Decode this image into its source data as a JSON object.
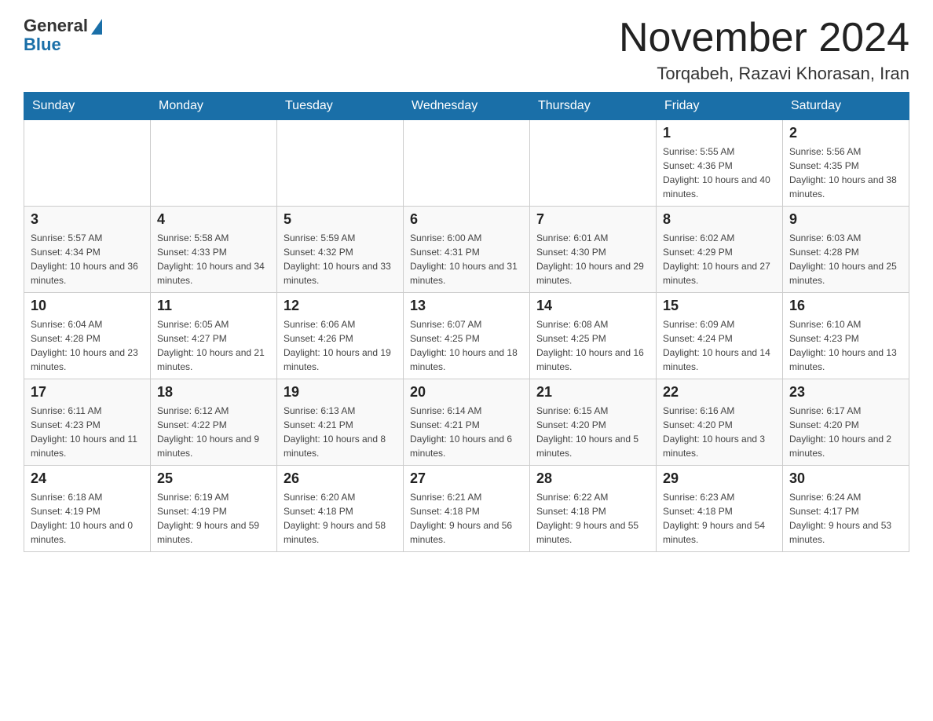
{
  "header": {
    "logo_general": "General",
    "logo_blue": "Blue",
    "month_title": "November 2024",
    "location": "Torqabeh, Razavi Khorasan, Iran"
  },
  "days_of_week": [
    "Sunday",
    "Monday",
    "Tuesday",
    "Wednesday",
    "Thursday",
    "Friday",
    "Saturday"
  ],
  "weeks": [
    [
      {
        "day": "",
        "sunrise": "",
        "sunset": "",
        "daylight": ""
      },
      {
        "day": "",
        "sunrise": "",
        "sunset": "",
        "daylight": ""
      },
      {
        "day": "",
        "sunrise": "",
        "sunset": "",
        "daylight": ""
      },
      {
        "day": "",
        "sunrise": "",
        "sunset": "",
        "daylight": ""
      },
      {
        "day": "",
        "sunrise": "",
        "sunset": "",
        "daylight": ""
      },
      {
        "day": "1",
        "sunrise": "Sunrise: 5:55 AM",
        "sunset": "Sunset: 4:36 PM",
        "daylight": "Daylight: 10 hours and 40 minutes."
      },
      {
        "day": "2",
        "sunrise": "Sunrise: 5:56 AM",
        "sunset": "Sunset: 4:35 PM",
        "daylight": "Daylight: 10 hours and 38 minutes."
      }
    ],
    [
      {
        "day": "3",
        "sunrise": "Sunrise: 5:57 AM",
        "sunset": "Sunset: 4:34 PM",
        "daylight": "Daylight: 10 hours and 36 minutes."
      },
      {
        "day": "4",
        "sunrise": "Sunrise: 5:58 AM",
        "sunset": "Sunset: 4:33 PM",
        "daylight": "Daylight: 10 hours and 34 minutes."
      },
      {
        "day": "5",
        "sunrise": "Sunrise: 5:59 AM",
        "sunset": "Sunset: 4:32 PM",
        "daylight": "Daylight: 10 hours and 33 minutes."
      },
      {
        "day": "6",
        "sunrise": "Sunrise: 6:00 AM",
        "sunset": "Sunset: 4:31 PM",
        "daylight": "Daylight: 10 hours and 31 minutes."
      },
      {
        "day": "7",
        "sunrise": "Sunrise: 6:01 AM",
        "sunset": "Sunset: 4:30 PM",
        "daylight": "Daylight: 10 hours and 29 minutes."
      },
      {
        "day": "8",
        "sunrise": "Sunrise: 6:02 AM",
        "sunset": "Sunset: 4:29 PM",
        "daylight": "Daylight: 10 hours and 27 minutes."
      },
      {
        "day": "9",
        "sunrise": "Sunrise: 6:03 AM",
        "sunset": "Sunset: 4:28 PM",
        "daylight": "Daylight: 10 hours and 25 minutes."
      }
    ],
    [
      {
        "day": "10",
        "sunrise": "Sunrise: 6:04 AM",
        "sunset": "Sunset: 4:28 PM",
        "daylight": "Daylight: 10 hours and 23 minutes."
      },
      {
        "day": "11",
        "sunrise": "Sunrise: 6:05 AM",
        "sunset": "Sunset: 4:27 PM",
        "daylight": "Daylight: 10 hours and 21 minutes."
      },
      {
        "day": "12",
        "sunrise": "Sunrise: 6:06 AM",
        "sunset": "Sunset: 4:26 PM",
        "daylight": "Daylight: 10 hours and 19 minutes."
      },
      {
        "day": "13",
        "sunrise": "Sunrise: 6:07 AM",
        "sunset": "Sunset: 4:25 PM",
        "daylight": "Daylight: 10 hours and 18 minutes."
      },
      {
        "day": "14",
        "sunrise": "Sunrise: 6:08 AM",
        "sunset": "Sunset: 4:25 PM",
        "daylight": "Daylight: 10 hours and 16 minutes."
      },
      {
        "day": "15",
        "sunrise": "Sunrise: 6:09 AM",
        "sunset": "Sunset: 4:24 PM",
        "daylight": "Daylight: 10 hours and 14 minutes."
      },
      {
        "day": "16",
        "sunrise": "Sunrise: 6:10 AM",
        "sunset": "Sunset: 4:23 PM",
        "daylight": "Daylight: 10 hours and 13 minutes."
      }
    ],
    [
      {
        "day": "17",
        "sunrise": "Sunrise: 6:11 AM",
        "sunset": "Sunset: 4:23 PM",
        "daylight": "Daylight: 10 hours and 11 minutes."
      },
      {
        "day": "18",
        "sunrise": "Sunrise: 6:12 AM",
        "sunset": "Sunset: 4:22 PM",
        "daylight": "Daylight: 10 hours and 9 minutes."
      },
      {
        "day": "19",
        "sunrise": "Sunrise: 6:13 AM",
        "sunset": "Sunset: 4:21 PM",
        "daylight": "Daylight: 10 hours and 8 minutes."
      },
      {
        "day": "20",
        "sunrise": "Sunrise: 6:14 AM",
        "sunset": "Sunset: 4:21 PM",
        "daylight": "Daylight: 10 hours and 6 minutes."
      },
      {
        "day": "21",
        "sunrise": "Sunrise: 6:15 AM",
        "sunset": "Sunset: 4:20 PM",
        "daylight": "Daylight: 10 hours and 5 minutes."
      },
      {
        "day": "22",
        "sunrise": "Sunrise: 6:16 AM",
        "sunset": "Sunset: 4:20 PM",
        "daylight": "Daylight: 10 hours and 3 minutes."
      },
      {
        "day": "23",
        "sunrise": "Sunrise: 6:17 AM",
        "sunset": "Sunset: 4:20 PM",
        "daylight": "Daylight: 10 hours and 2 minutes."
      }
    ],
    [
      {
        "day": "24",
        "sunrise": "Sunrise: 6:18 AM",
        "sunset": "Sunset: 4:19 PM",
        "daylight": "Daylight: 10 hours and 0 minutes."
      },
      {
        "day": "25",
        "sunrise": "Sunrise: 6:19 AM",
        "sunset": "Sunset: 4:19 PM",
        "daylight": "Daylight: 9 hours and 59 minutes."
      },
      {
        "day": "26",
        "sunrise": "Sunrise: 6:20 AM",
        "sunset": "Sunset: 4:18 PM",
        "daylight": "Daylight: 9 hours and 58 minutes."
      },
      {
        "day": "27",
        "sunrise": "Sunrise: 6:21 AM",
        "sunset": "Sunset: 4:18 PM",
        "daylight": "Daylight: 9 hours and 56 minutes."
      },
      {
        "day": "28",
        "sunrise": "Sunrise: 6:22 AM",
        "sunset": "Sunset: 4:18 PM",
        "daylight": "Daylight: 9 hours and 55 minutes."
      },
      {
        "day": "29",
        "sunrise": "Sunrise: 6:23 AM",
        "sunset": "Sunset: 4:18 PM",
        "daylight": "Daylight: 9 hours and 54 minutes."
      },
      {
        "day": "30",
        "sunrise": "Sunrise: 6:24 AM",
        "sunset": "Sunset: 4:17 PM",
        "daylight": "Daylight: 9 hours and 53 minutes."
      }
    ]
  ]
}
